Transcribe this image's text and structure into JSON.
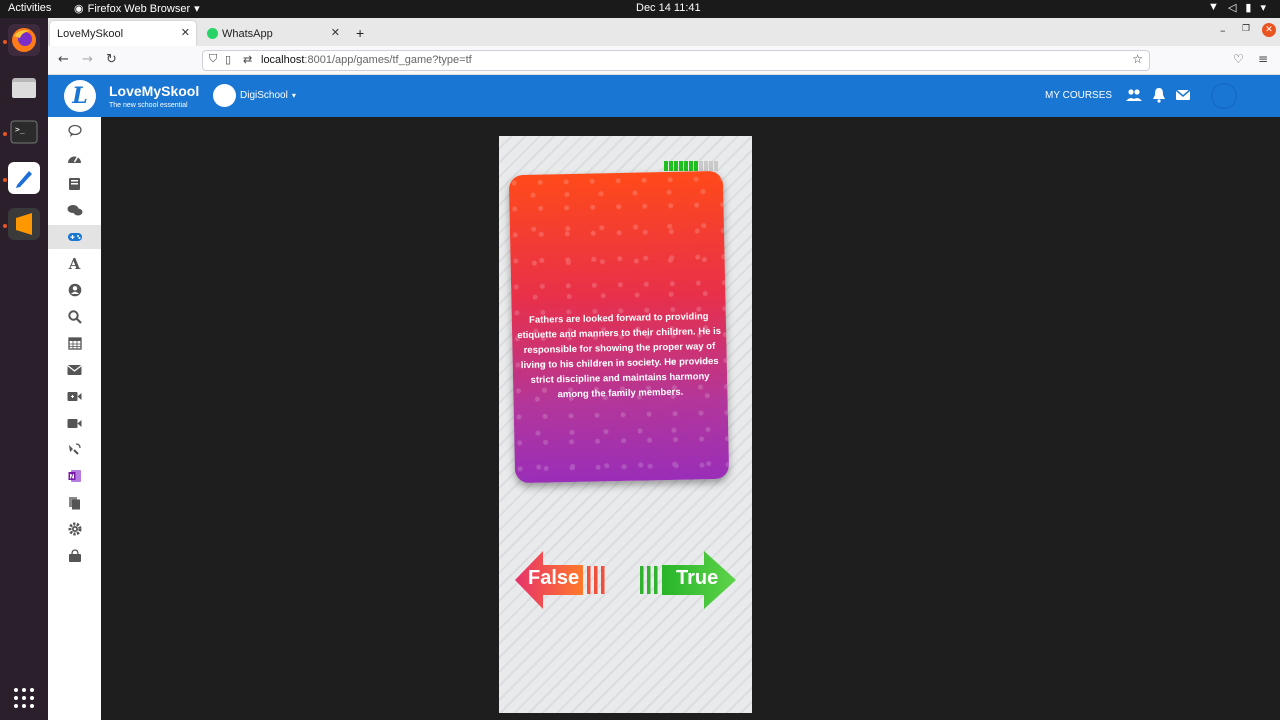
{
  "system": {
    "activities": "Activities",
    "app_menu": "Firefox Web Browser",
    "clock": "Dec 14  11:41"
  },
  "browser": {
    "tabs": [
      {
        "label": "LoveMySkool"
      },
      {
        "label": "WhatsApp"
      }
    ],
    "url_host": "localhost",
    "url_rest": ":8001/app/games/tf_game?type=tf"
  },
  "header": {
    "brand": "LoveMySkool",
    "tagline": "The new school essential",
    "school": "DigiSchool",
    "my_courses": "MY COURSES",
    "accent": "#1976d2"
  },
  "sidebar": {
    "items": [
      {
        "icon": "chat-bubble-icon"
      },
      {
        "icon": "dashboard-icon"
      },
      {
        "icon": "book-icon"
      },
      {
        "icon": "forum-icon"
      },
      {
        "icon": "gamepad-icon",
        "selected": true
      },
      {
        "icon": "font-icon"
      },
      {
        "icon": "user-circle-icon"
      },
      {
        "icon": "search-icon"
      },
      {
        "icon": "calendar-icon"
      },
      {
        "icon": "mail-icon"
      },
      {
        "icon": "video-call-icon"
      },
      {
        "icon": "video-camera-icon"
      },
      {
        "icon": "satellite-icon"
      },
      {
        "icon": "onenote-icon"
      },
      {
        "icon": "files-icon"
      },
      {
        "icon": "settings-icon"
      },
      {
        "icon": "shop-bag-icon"
      }
    ]
  },
  "game": {
    "progress": {
      "filled": 7,
      "total": 11
    },
    "statement": "Fathers are looked forward to providing etiquette and manners to their children. He is responsible for showing the proper way of living to his children in society. He provides strict discipline and maintains harmony among the family members.",
    "false_label": "False",
    "true_label": "True"
  }
}
